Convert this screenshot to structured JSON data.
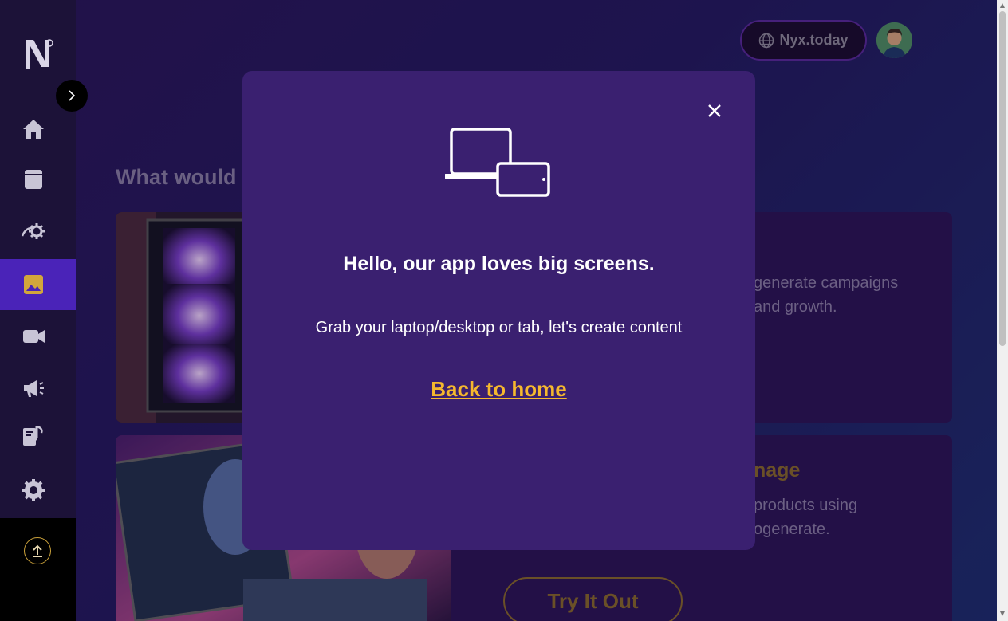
{
  "header": {
    "domain_label": "Nyx.today"
  },
  "main": {
    "section_title": "What would",
    "card1": {
      "desc_line1": "generate campaigns",
      "desc_line2": "and growth."
    },
    "card2": {
      "heading": "nage",
      "desc_line1": "products using",
      "desc_line2": "ogenerate.",
      "cta": "Try It Out"
    }
  },
  "modal": {
    "title": "Hello, our app loves big screens.",
    "subtitle": "Grab your laptop/desktop or tab, let's create content",
    "link": "Back to home"
  },
  "icons": {
    "brand": "nyx-logo-icon",
    "accent": "#4a23b8",
    "link_color": "#f5b82e"
  }
}
